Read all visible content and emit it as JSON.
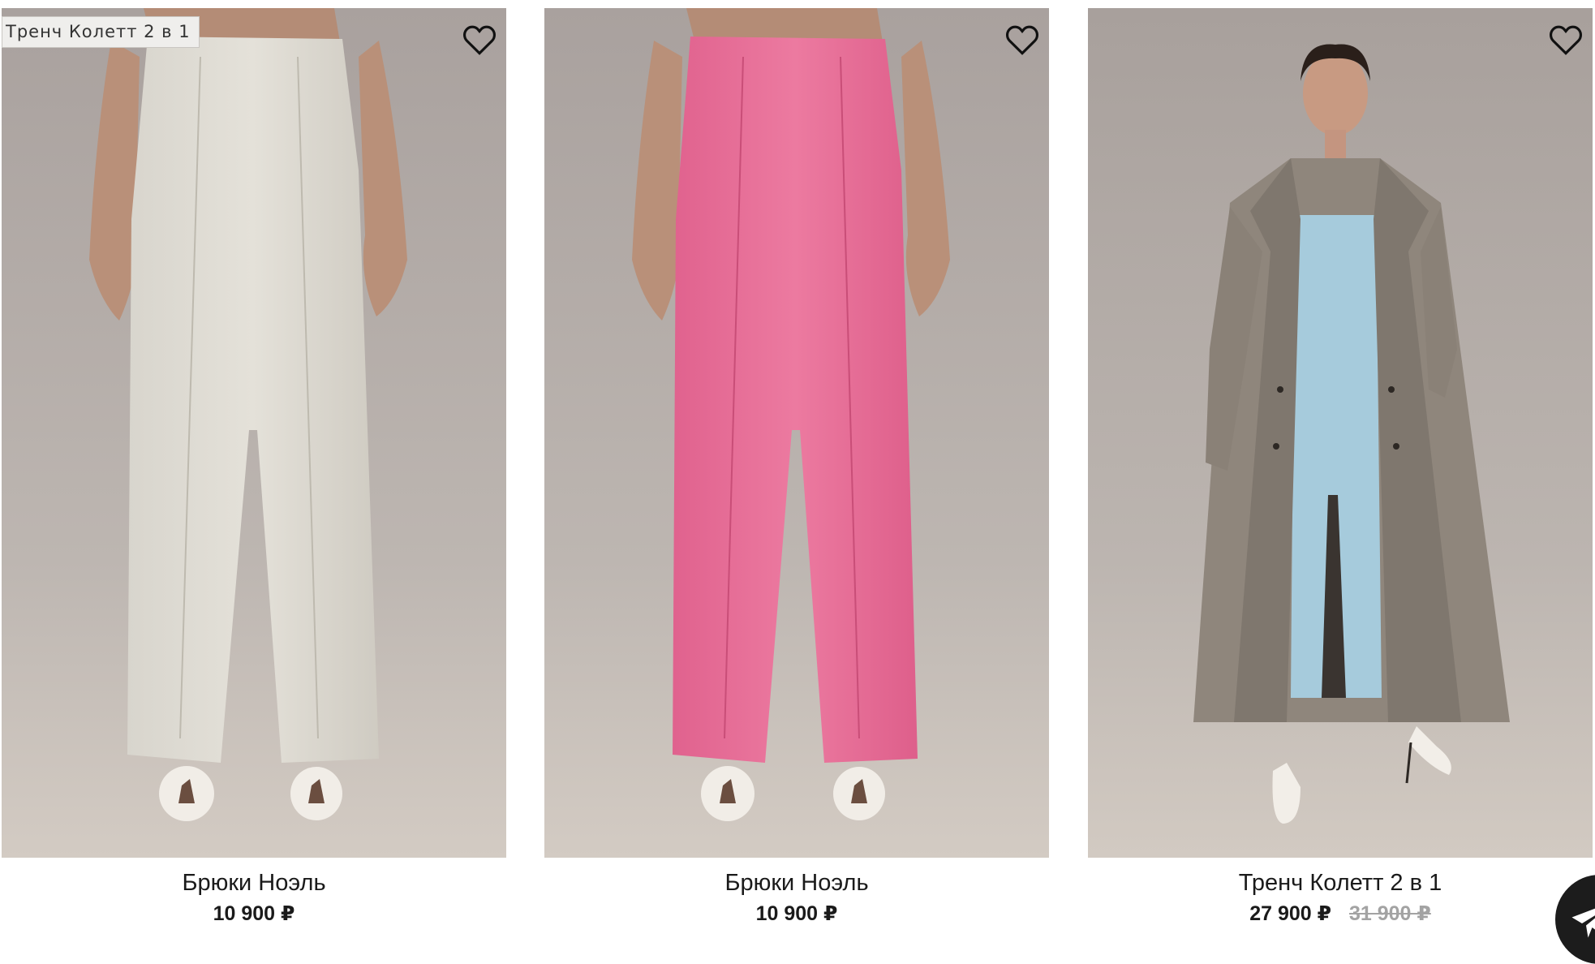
{
  "tooltip": {
    "text": "Тренч Колетт 2 в 1"
  },
  "products": [
    {
      "name": "Брюки Ноэль",
      "price": "10 900 ₽",
      "old_price": ""
    },
    {
      "name": "Брюки Ноэль",
      "price": "10 900 ₽",
      "old_price": ""
    },
    {
      "name": "Тренч Колетт 2 в 1",
      "price": "27 900 ₽",
      "old_price": "31 900 ₽"
    }
  ],
  "icons": {
    "favorite": "heart-outline-icon",
    "chat": "telegram-plane-icon"
  },
  "colors": {
    "text": "#1a1a1a",
    "old_price": "#a3a3a3",
    "background": "#ffffff",
    "chat_button": "#1c1c1c"
  }
}
